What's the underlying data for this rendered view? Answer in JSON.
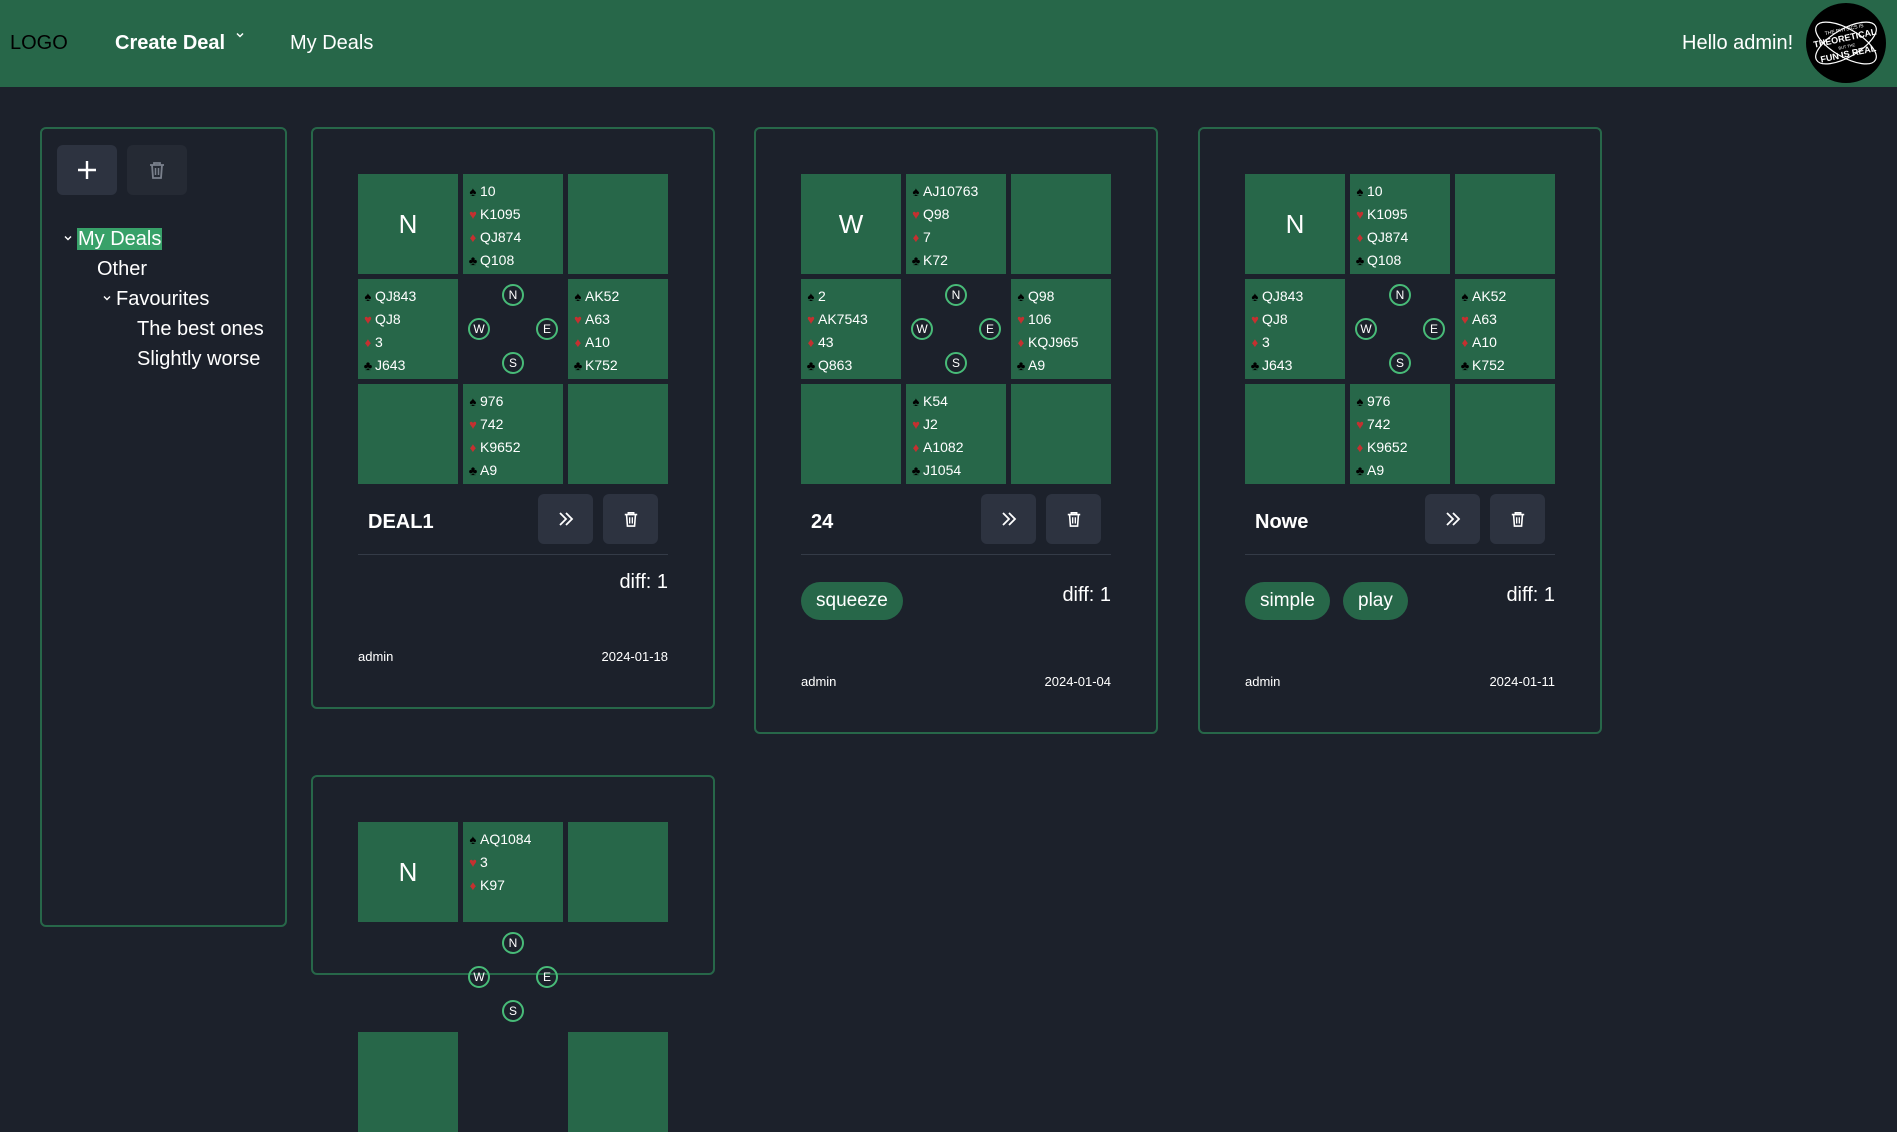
{
  "header": {
    "logo": "LOGO",
    "create_deal": "Create Deal",
    "my_deals": "My Deals",
    "greeting": "Hello admin!",
    "avatar_text": [
      "THE PHYSICS IS",
      "THEORETICAL",
      "BUT THE",
      "FUN IS REAL"
    ]
  },
  "sidebar": {
    "add_icon": "plus-icon",
    "delete_icon": "trash-icon",
    "tree": {
      "root": "My Deals",
      "other": "Other",
      "favourites": "Favourites",
      "best": "The best ones",
      "worse": "Slightly worse"
    }
  },
  "compass": {
    "n": "N",
    "w": "W",
    "e": "E",
    "s": "S"
  },
  "colors": {
    "accent": "#276749",
    "selected": "#38a169",
    "background": "#1c212b",
    "heart": "#c53030"
  },
  "suits": {
    "spade": "♠",
    "heart": "♥",
    "diamond": "♦",
    "club": "♣"
  },
  "deals": [
    {
      "dealer": "N",
      "title": "DEAL1",
      "diff": "diff: 1",
      "tags": [],
      "author": "admin",
      "date": "2024-01-18",
      "hands": {
        "north": [
          "10",
          "K1095",
          "QJ874",
          "Q108"
        ],
        "west": [
          "QJ843",
          "QJ8",
          "3",
          "J643"
        ],
        "east": [
          "AK52",
          "A63",
          "A10",
          "K752"
        ],
        "south": [
          "976",
          "742",
          "K9652",
          "A9"
        ]
      }
    },
    {
      "dealer": "W",
      "title": "24",
      "diff": "diff: 1",
      "tags": [
        "squeeze"
      ],
      "author": "admin",
      "date": "2024-01-04",
      "hands": {
        "north": [
          "AJ10763",
          "Q98",
          "7",
          "K72"
        ],
        "west": [
          "2",
          "AK7543",
          "43",
          "Q863"
        ],
        "east": [
          "Q98",
          "106",
          "KQJ965",
          "A9"
        ],
        "south": [
          "K54",
          "J2",
          "A1082",
          "J1054"
        ]
      }
    },
    {
      "dealer": "N",
      "title": "Nowe",
      "diff": "diff: 1",
      "tags": [
        "simple",
        "play"
      ],
      "author": "admin",
      "date": "2024-01-11",
      "hands": {
        "north": [
          "10",
          "K1095",
          "QJ874",
          "Q108"
        ],
        "west": [
          "QJ843",
          "QJ8",
          "3",
          "J643"
        ],
        "east": [
          "AK52",
          "A63",
          "A10",
          "K752"
        ],
        "south": [
          "976",
          "742",
          "K9652",
          "A9"
        ]
      }
    },
    {
      "dealer": "N",
      "title": "",
      "hands": {
        "north": [
          "AQ1084",
          "3",
          "K97"
        ]
      }
    }
  ]
}
